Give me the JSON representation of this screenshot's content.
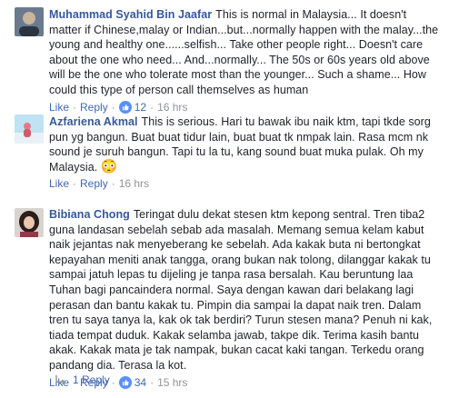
{
  "comments": [
    {
      "author": "Muhammad Syahid Bin Jaafar",
      "text": "This is normal in Malaysia... It doesn't matter if Chinese,malay or Indian...but...normally happen with the malay...the young and healthy one......selfish... Take other people right... Doesn't care about the one who need... And...normally... The 50s or 60s years old above will be the one who tolerate most than the younger... Such a shame... How could this type of person call themselves as human",
      "like": "Like",
      "reply": "Reply",
      "reactions": "12",
      "time": "16 hrs"
    },
    {
      "author": "Azfariena Akmal",
      "text": "This is serious. Hari tu bawak ibu naik ktm, tapi tkde sorg pun yg bangun. Buat buat tidur lain, buat buat tk nmpak lain. Rasa mcm nk sound je suruh bangun. Tapi tu la tu, kang sound buat muka pulak. Oh my Malaysia.",
      "emoji": "😳",
      "like": "Like",
      "reply": "Reply",
      "time": "16 hrs"
    },
    {
      "author": "Bibiana Chong",
      "text": "Teringat dulu dekat stesen ktm kepong sentral. Tren tiba2 guna landasan sebelah sebab ada masalah. Memang semua kelam kabut naik jejantas nak menyeberang ke sebelah. Ada kakak buta ni bertongkat kepayahan meniti anak tangga, orang bukan nak tolong, dilanggar kakak tu sampai jatuh lepas tu dijeling je tanpa rasa bersalah. Kau beruntung laa Tuhan bagi pancaindera normal. Saya dengan kawan dari belakang lagi perasan dan bantu kakak tu. Pimpin dia sampai la dapat naik tren. Dalam tren tu saya tanya la, kak ok tak berdiri? Turun stesen mana? Penuh ni kak, tiada tempat duduk. Kakak selamba jawab, takpe dik. Terima kasih bantu akak. Kakak mata je tak nampak, bukan cacat kaki tangan. Terkedu orang pandang dia. Terasa la kot.",
      "like": "Like",
      "reply": "Reply",
      "reactions": "34",
      "time": "15 hrs"
    }
  ],
  "replies_link": "1 Reply",
  "colors": {
    "author": "#365899",
    "link": "#4267b2",
    "muted": "#90949c",
    "like_blue": "#5890ff"
  },
  "icons": [
    "like-reaction-icon",
    "reply-arrow-icon"
  ]
}
